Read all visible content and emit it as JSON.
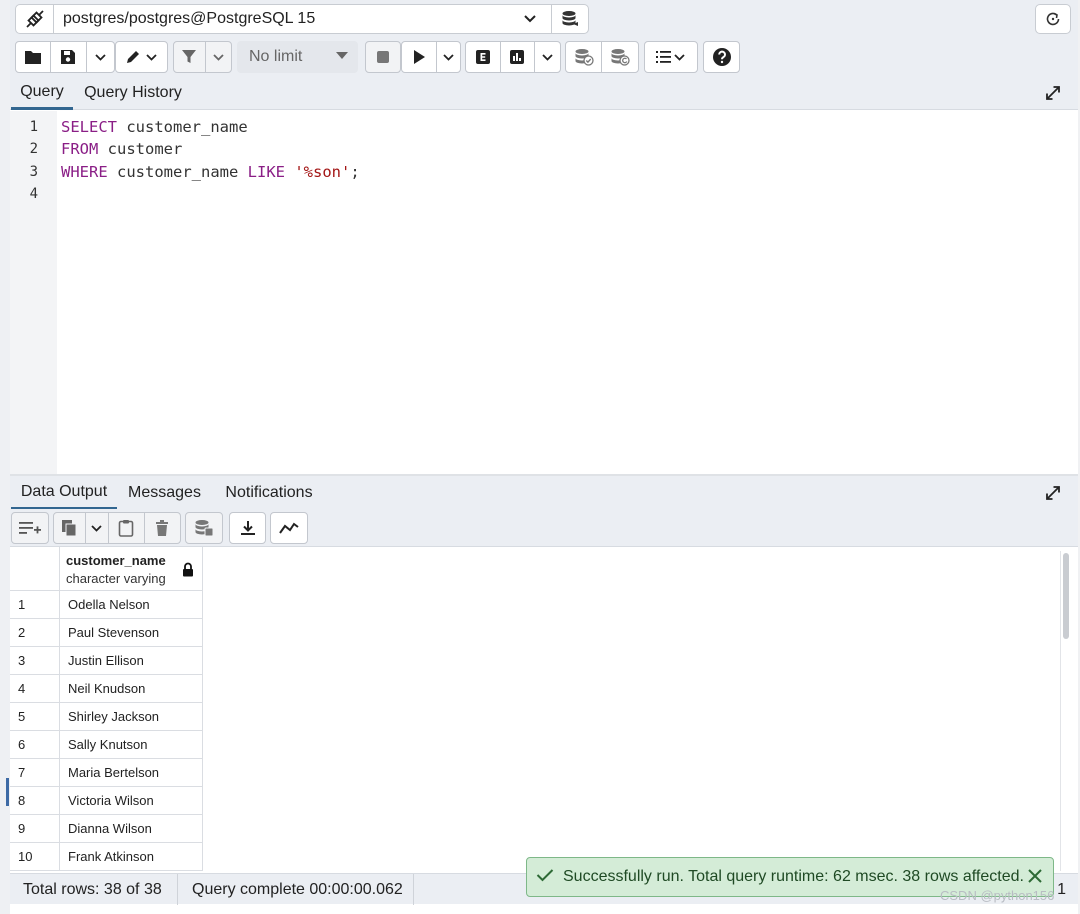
{
  "connection": {
    "label": "postgres/postgres@PostgreSQL 15"
  },
  "toolbar": {
    "limit_label": "No limit"
  },
  "editor_tabs": [
    {
      "label": "Query"
    },
    {
      "label": "Query History"
    }
  ],
  "editor": {
    "line_numbers": [
      "1",
      "2",
      "3",
      "4"
    ]
  },
  "output_tabs": [
    {
      "label": "Data Output"
    },
    {
      "label": "Messages"
    },
    {
      "label": "Notifications"
    }
  ],
  "grid": {
    "column": {
      "name": "customer_name",
      "type": "character varying"
    },
    "rows": [
      {
        "n": "1",
        "value": "Odella Nelson"
      },
      {
        "n": "2",
        "value": "Paul Stevenson"
      },
      {
        "n": "3",
        "value": "Justin Ellison"
      },
      {
        "n": "4",
        "value": "Neil Knudson"
      },
      {
        "n": "5",
        "value": "Shirley Jackson"
      },
      {
        "n": "6",
        "value": "Sally Knutson"
      },
      {
        "n": "7",
        "value": "Maria Bertelson"
      },
      {
        "n": "8",
        "value": "Victoria Wilson"
      },
      {
        "n": "9",
        "value": "Dianna Wilson"
      },
      {
        "n": "10",
        "value": "Frank Atkinson"
      }
    ]
  },
  "status": {
    "total_rows": "Total rows: 38 of 38",
    "query_complete": "Query complete 00:00:00.062",
    "cursor": "Ln 1"
  },
  "toast": {
    "message": "Successfully run. Total query runtime: 62 msec. 38 rows affected."
  },
  "watermark": "CSDN @python156",
  "colors": {
    "accent": "#326690",
    "keyword": "#8a1e86",
    "string": "#a31515",
    "success_bg": "#d4ecd7"
  }
}
